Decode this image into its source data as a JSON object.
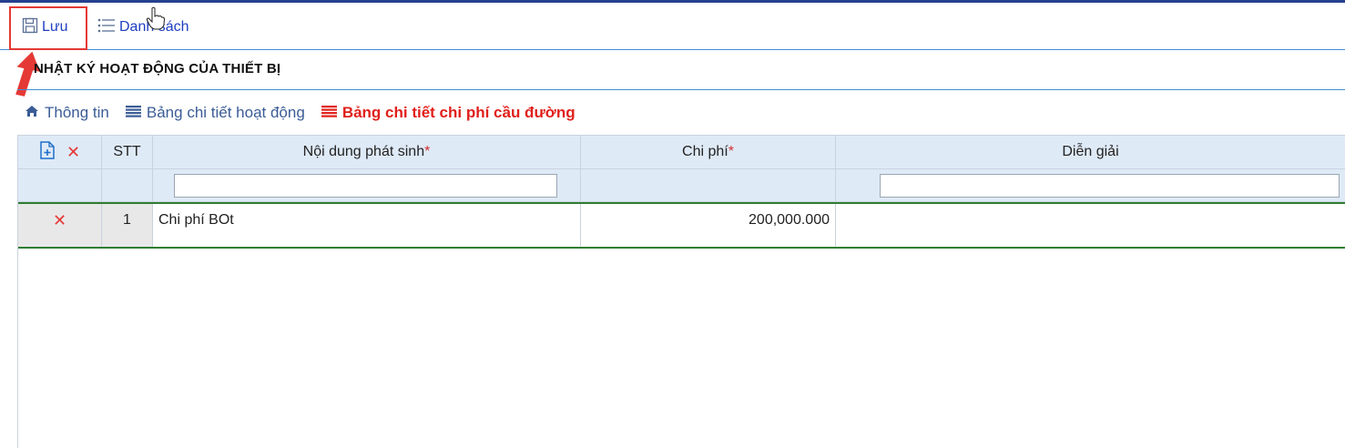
{
  "toolbar": {
    "save_label": "Lưu",
    "save_icon": "save-icon",
    "list_label": "Danh sách",
    "list_icon": "list-icon"
  },
  "page_title": "NHẬT KÝ HOẠT ĐỘNG CỦA THIẾT BỊ",
  "tabs": [
    {
      "label": "Thông tin",
      "icon": "home-icon",
      "active": false
    },
    {
      "label": "Bảng chi tiết hoạt động",
      "icon": "table-icon",
      "active": false
    },
    {
      "label": "Bảng chi tiết chi phí cầu đường",
      "icon": "table-icon",
      "active": true
    }
  ],
  "grid": {
    "headers": {
      "actions": "",
      "stt": "STT",
      "content": "Nội dung phát sinh",
      "cost": "Chi phí",
      "description": "Diễn giải",
      "required_marker": "*"
    },
    "filters": {
      "content_value": "",
      "description_value": ""
    },
    "rows": [
      {
        "stt": "1",
        "content": "Chi phí BOt",
        "cost": "200,000.000",
        "description": ""
      }
    ]
  },
  "colors": {
    "accent": "#1f3fc2",
    "active_tab": "#e0201b",
    "header_bg": "#dfeaf7",
    "row_border": "#2e7d32",
    "highlight": "#e53935"
  }
}
